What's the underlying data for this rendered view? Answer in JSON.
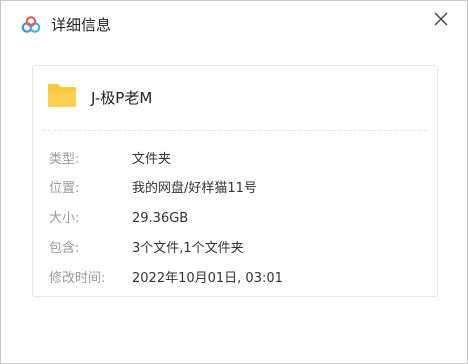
{
  "window": {
    "title": "详细信息",
    "app_icon": "baidu-netdisk-cloud-icon",
    "close_icon": "close-icon"
  },
  "file": {
    "icon": "folder-icon",
    "icon_color": "#F9C83B",
    "name": "J-极P老M"
  },
  "details": [
    {
      "label": "类型:",
      "value": "文件夹"
    },
    {
      "label": "位置:",
      "value": "我的网盘/好样猫11号"
    },
    {
      "label": "大小:",
      "value": "29.36GB"
    },
    {
      "label": "包含:",
      "value": "3个文件,1个文件夹"
    },
    {
      "label": "修改时间:",
      "value": "2022年10月01日, 03:01"
    }
  ],
  "colors": {
    "accent_blue": "#3E8EF7",
    "label_gray": "#9A9A9A",
    "value_text": "#333333"
  }
}
